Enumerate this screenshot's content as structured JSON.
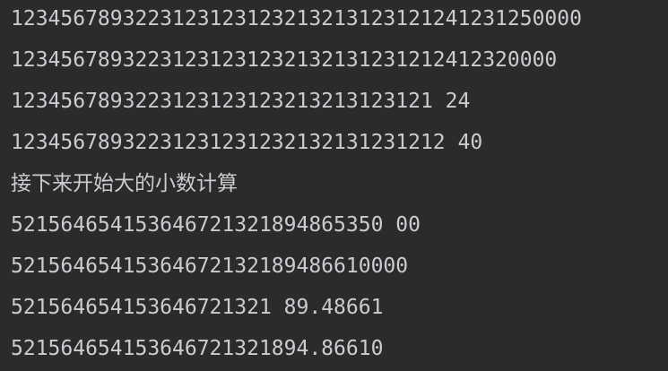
{
  "console": {
    "lines": [
      "1234567893223123123123213213123121241231250000",
      "12345678932231231231232132131231212412320000",
      "1234567893223123123123213213123121 24",
      "12345678932231231231232132131231212 40",
      "接下来开始大的小数计算",
      "521564654153646721321894865350 00",
      "52156465415364672132189486610000",
      "521564654153646721321 89.48661",
      "521564654153646721321894.86610"
    ]
  }
}
